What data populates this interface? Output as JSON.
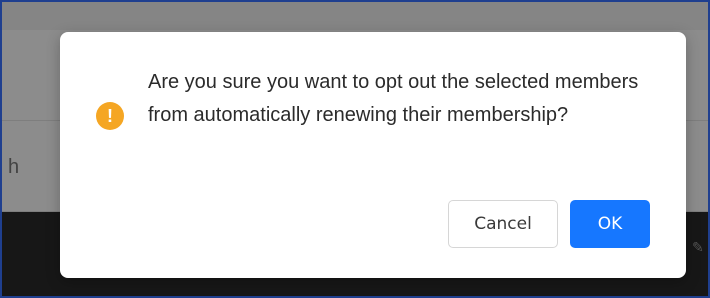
{
  "background": {
    "partial_letter": "h",
    "edit_icon": "edit-icon"
  },
  "dialog": {
    "icon": "exclamation-circle-icon",
    "icon_glyph": "!",
    "icon_color": "#f5a623",
    "message": "Are you sure you want to opt out the selected members from automatically renewing their membership?",
    "cancel_label": "Cancel",
    "ok_label": "OK",
    "ok_color": "#1677ff"
  }
}
